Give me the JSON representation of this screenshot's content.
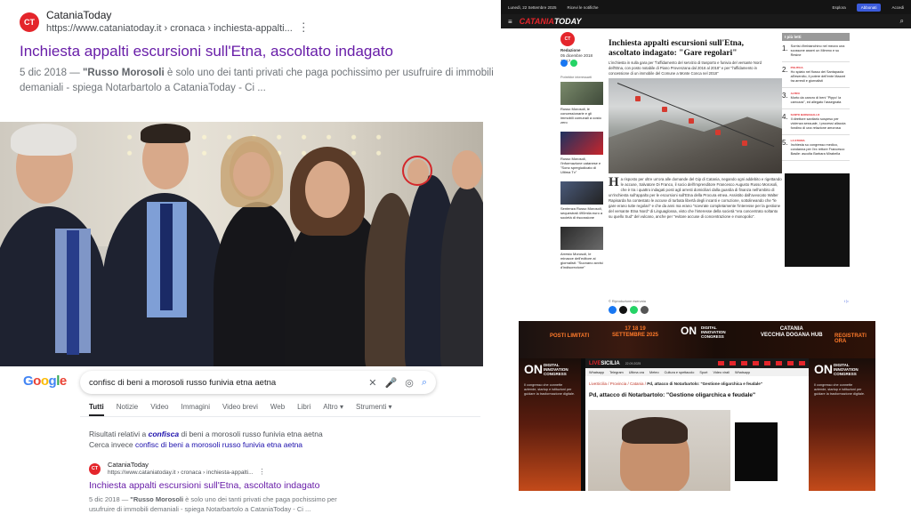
{
  "google_result": {
    "site_logo_text": "CT",
    "site_name": "CataniaToday",
    "site_url": "https://www.cataniatoday.it › cronaca › inchiesta-appalti...",
    "title": "Inchiesta appalti escursioni sull'Etna, ascoltato indagato",
    "snippet_date": "5 dic 2018 — ",
    "snippet_bold": "\"Russo Morosoli",
    "snippet_rest": " è solo uno dei tanti privati che paga pochissimo per usufruire di immobili demaniali - spiega Notarbartolo a CataniaToday - Ci ..."
  },
  "google_search": {
    "logo": [
      "G",
      "o",
      "o",
      "g",
      "l",
      "e"
    ],
    "query": "confisc di beni a morosoli russo funivia etna aetna",
    "tabs": [
      "Tutti",
      "Notizie",
      "Video",
      "Immagini",
      "Video brevi",
      "Web",
      "Libri",
      "Altro ▾",
      "Strumenti ▾"
    ],
    "related_prefix": "Risultati relativi a ",
    "related_bold": "confisca",
    "related_suffix": " di beni a morosoli russo funivia etna aetna",
    "instead_prefix": "Cerca invece ",
    "instead_link": "confisc di beni a morosoli russo funivia etna aetna",
    "result": {
      "site_name": "CataniaToday",
      "site_url": "https://www.cataniatoday.it › cronaca › inchiesta-appalti...",
      "title": "Inchiesta appalti escursioni sull'Etna, ascoltato indagato",
      "snippet_date": "5 dic 2018 — ",
      "snippet_bold": "\"Russo Morosoli",
      "snippet_rest": " è solo uno dei tanti privati che paga pochissimo per usufruire di immobili demaniali - spiega Notarbartolo a CataniaToday - Ci ..."
    }
  },
  "catania_article": {
    "topbar_date": "Lunedì, 22 Settembre 2025",
    "topbar_alerts": "Ricevi le notifiche",
    "topbar_explore": "Esplora",
    "topbar_btn": "Abbonati",
    "topbar_login": "Accedi",
    "brand_prefix": "CATANIA",
    "brand_suffix": "TODAY",
    "author": "Redazione",
    "author_date": "05 dicembre 2018 10:17",
    "title": "Inchiesta appalti escursioni sull'Etna, ascoltato indagato: \"Gare regolari\"",
    "lead": "L'inchiesta in sulla gara per \"l'affidamento del servizio di trasporto e funivia del versante Nord dell'Etna, con posto notabile di Piano Provenzana dal 2016 al 2018\" e per \"l'affidamento in concessione di un immobile del Comune a Monte Conca nel 2018\"",
    "body_dropcap": "H",
    "body": "a risposto per oltre un'ora alle domande del Gip di Catania, negando ogni addebito e rigettando le accuse, Salvatore Di Franco, il socio dell'imprenditore Francesco Augusto Russo Morosoli, che è tra i quattro indagati posti agli arresti domiciliari dalla guardia di finanza nell'ambito di un'inchiesta sull'appalto per le escursioni sull'Etna della Procura etnea. Assistito dall'avvocato Walter Rapisarda ha contestato le accuse di turbata libertà degli incanti e corruzione, sottolineando che \"le gare erano tutte regolari\" e che da anni ma erano \"scevrate completamente l'interesse per la gestione del versante Etna Nord\" di Linguaglossa, visto che l'interesse della società \"era concentrato soltanto su quello Sud\" del vulcano, anche per \"evitare accuse di concentrazione e monopolio\".",
    "side_label": "Potrebbe interessarti",
    "side_items": [
      "Russo Morosoli, le concessionarie e gli immobili comunali a costo zero",
      "Russo Morosoli, l'informazione catanese e \"Sono spregiudicato di Ultima Tv\"",
      "Sentenza Russo Morosoli, sequestrati 490mila euro a società di riscossione",
      "Arresto Morosoli, le minacce dell'editore ai giornalisti: \"Suonano avvisi d'indiscrezione\""
    ],
    "share_label": "© Riproduzione riservata",
    "right_header": "I più letti",
    "right_items": [
      {
        "num": "1.",
        "tag": "",
        "text": "Sorrisi d'imbianchino nel mezzo una scossone asserì un Mimmo e su Resine"
      },
      {
        "num": "2.",
        "tag": "POLITICA",
        "text": "Ho spiato nel flusso dei Santapaola all'esercito, il potere dell'ente Mazzei tra arresti e giornalisti"
      },
      {
        "num": "3.",
        "tag": "ALTRO",
        "text": "Morto da cancro di beni \"Pippo' la carrozza\", ed allegato l'assegnata"
      },
      {
        "num": "4.",
        "tag": "SANTO BARBAGALLO",
        "text": "Il direttore sanitario sospeso per violenza sessuale, i processi allaccia fondino di una relazione amorosa"
      },
      {
        "num": "5.",
        "tag": "LA STORIA",
        "text": "Inchiesta su congresso medico, condanna per l'ex rettore Francesco Basile: ascolta Barbara Mirabella"
      }
    ],
    "ad_label": "i ▷"
  },
  "livesicilia": {
    "banner_posti": "POSTI LIMITATI",
    "banner_days": "17 18 19\nSETTEMBRE 2025",
    "banner_on": "ON",
    "banner_dig": "DIGITAL\nINNOVATION\nCONGRESS",
    "banner_city": "CATANIA\nVECCHIA DOGANA HUB",
    "banner_reg": "REGISTRATI ORA",
    "side_text": "Il congresso che connette aziende, startup e istituzioni per guidare la trasformazione digitale.",
    "logo_prefix": "LIVE",
    "logo_suffix": "SICILIA",
    "date": "22.09.2025",
    "nav": [
      "Whatsapp",
      "Telegram",
      "Ultima ora",
      "Meteo",
      "Cultura e spettacolo",
      "Sport",
      "Video virali",
      "Whatsapp"
    ],
    "breadcrumb_a": "LiveSicilia",
    "breadcrumb_b": " / Provincia / Catania / ",
    "breadcrumb_c": "Pd, attacco di Notarbartolo: \"Gestione oligarchica e feudale\"",
    "title": "Pd, attacco di Notarbartolo: \"Gestione oligarchica e feudale\""
  },
  "colors": {
    "google_link_visited": "#681da8",
    "google_link": "#1a0dab",
    "cataniatoday_red": "#e4252b",
    "livesicilia_orange": "#ff7a2a"
  }
}
